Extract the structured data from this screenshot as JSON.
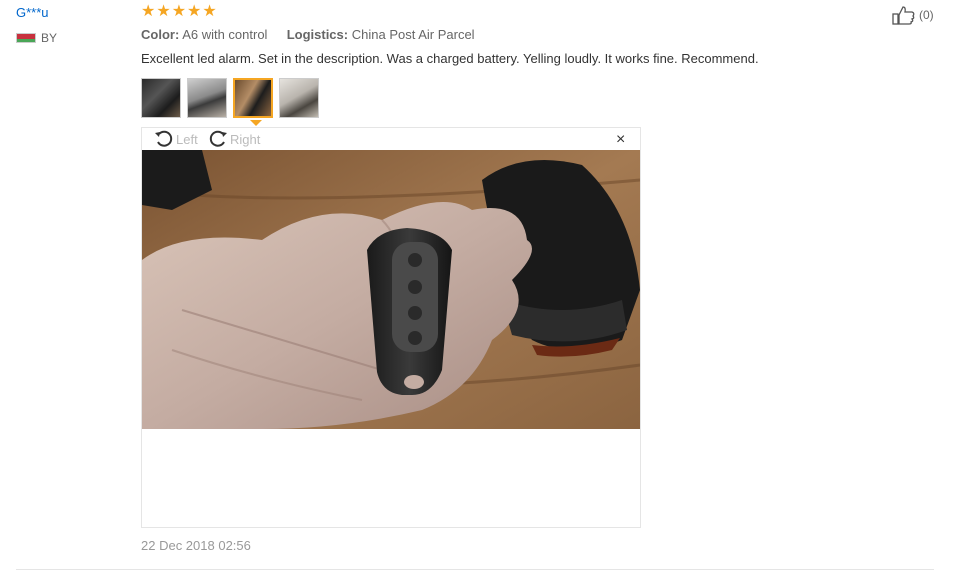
{
  "review": {
    "user_name": "G***u",
    "country_code": "BY",
    "rating": 5,
    "stars": [
      "★",
      "★",
      "★",
      "★",
      "★"
    ],
    "color_label": "Color:",
    "color_value": "A6 with control",
    "logistics_label": "Logistics:",
    "logistics_value": "China Post Air Parcel",
    "text": "Excellent led alarm. Set in the description. Was a charged battery. Yelling loudly. It works fine. Recommend.",
    "date": "22 Dec 2018 02:56",
    "helpful_count": "(0)"
  },
  "viewer": {
    "rotate_left_label": "Left",
    "rotate_right_label": "Right",
    "close_glyph": "×",
    "active_thumbnail_index": 2
  },
  "colors": {
    "star": "#f5a623",
    "user_link": "#0066cc",
    "active_thumb_border": "#f5a623"
  }
}
